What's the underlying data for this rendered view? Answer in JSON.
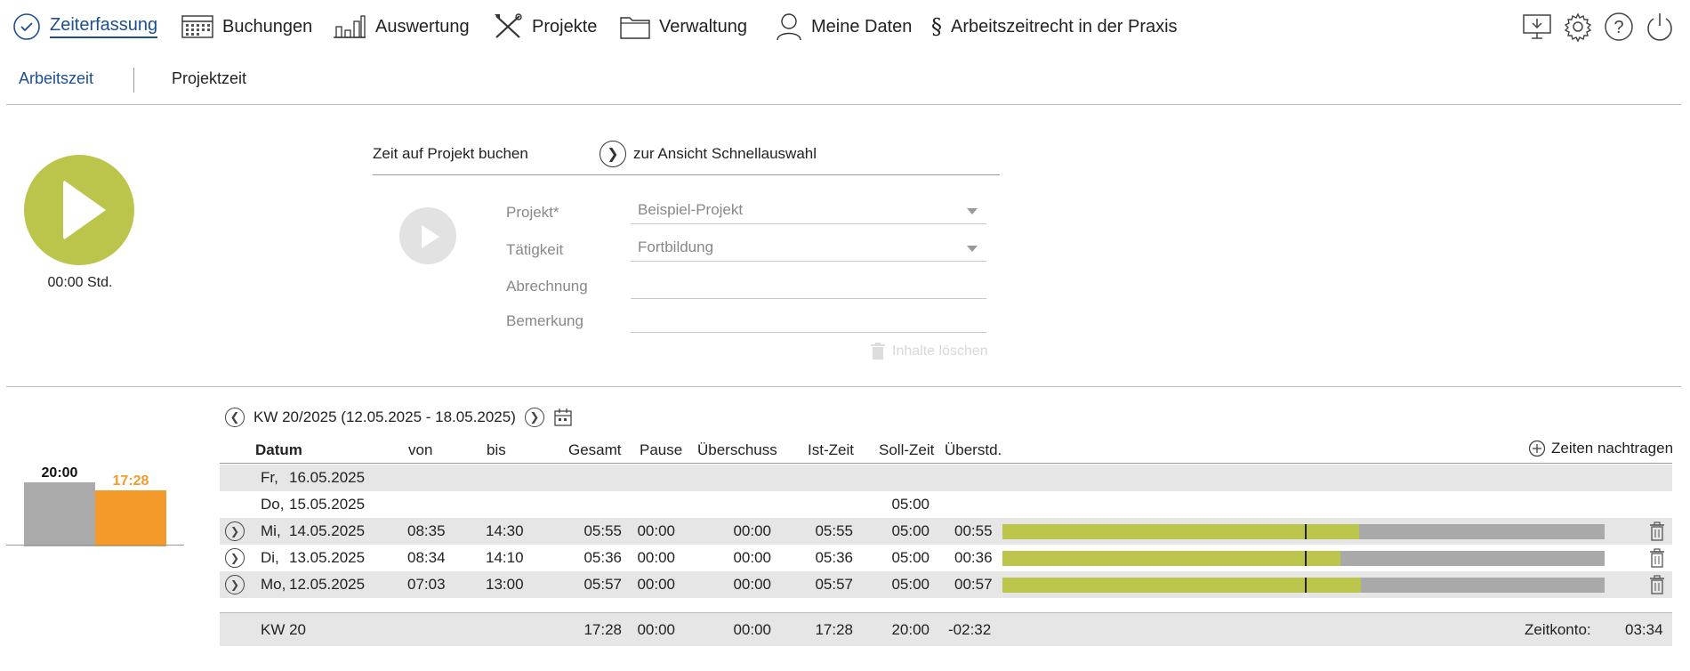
{
  "nav": {
    "items": [
      {
        "label": "Zeiterfassung",
        "icon": "clock-check-icon",
        "active": true
      },
      {
        "label": "Buchungen",
        "icon": "calendar-grid-icon"
      },
      {
        "label": "Auswertung",
        "icon": "bar-chart-icon"
      },
      {
        "label": "Projekte",
        "icon": "tools-icon"
      },
      {
        "label": "Verwaltung",
        "icon": "folder-icon"
      },
      {
        "label": "Meine Daten",
        "icon": "user-icon"
      },
      {
        "label": "Arbeitszeitrecht in der Praxis",
        "icon": "paragraph-icon",
        "glyph": "§"
      }
    ],
    "utilities": [
      "monitor-download-icon",
      "settings-gear-icon",
      "help-icon",
      "power-icon"
    ]
  },
  "subnav": {
    "tabs": [
      {
        "label": "Arbeitszeit",
        "active": true
      },
      {
        "label": "Projektzeit"
      }
    ]
  },
  "timer": {
    "label": "00:00 Std.",
    "color": "#bcc54b"
  },
  "booking": {
    "title": "Zeit auf Projekt buchen",
    "quick_link": "zur Ansicht Schnellauswahl",
    "fields": {
      "projekt": {
        "label": "Projekt*",
        "value": "Beispiel-Projekt"
      },
      "taetigkeit": {
        "label": "Tätigkeit",
        "value": "Fortbildung"
      },
      "abrechnung": {
        "label": "Abrechnung",
        "value": ""
      },
      "bemerkung": {
        "label": "Bemerkung",
        "value": ""
      }
    },
    "clear_label": "Inhalte löschen"
  },
  "chart": {
    "soll": {
      "label": "20:00",
      "value": 20.0,
      "color": "#aaaaaa"
    },
    "ist": {
      "label": "17:28",
      "value": 17.47,
      "color": "#f39a2b"
    }
  },
  "week": {
    "label": "KW 20/2025 (12.05.2025 - 18.05.2025)"
  },
  "table": {
    "headers": {
      "datum": "Datum",
      "von": "von",
      "bis": "bis",
      "gesamt": "Gesamt",
      "pause": "Pause",
      "ueberschuss": "Überschuss",
      "ist": "Ist-Zeit",
      "soll": "Soll-Zeit",
      "ueberstd": "Überstd."
    },
    "add_label": "Zeiten nachtragen",
    "rows": [
      {
        "day": "Fr,",
        "date": "16.05.2025",
        "von": "",
        "bis": "",
        "gesamt": "",
        "pause": "",
        "ueberschuss": "",
        "ist": "",
        "soll": "",
        "ueberstd": "",
        "progress": null
      },
      {
        "day": "Do,",
        "date": "15.05.2025",
        "von": "",
        "bis": "",
        "gesamt": "",
        "pause": "",
        "ueberschuss": "",
        "ist": "",
        "soll": "05:00",
        "ueberstd": "",
        "progress": null
      },
      {
        "day": "Mi,",
        "date": "14.05.2025",
        "von": "08:35",
        "bis": "14:30",
        "gesamt": "05:55",
        "pause": "00:00",
        "ueberschuss": "00:00",
        "ist": "05:55",
        "soll": "05:00",
        "ueberstd": "00:55",
        "progress": 0.593
      },
      {
        "day": "Di,",
        "date": "13.05.2025",
        "von": "08:34",
        "bis": "14:10",
        "gesamt": "05:36",
        "pause": "00:00",
        "ueberschuss": "00:00",
        "ist": "05:36",
        "soll": "05:00",
        "ueberstd": "00:36",
        "progress": 0.562
      },
      {
        "day": "Mo,",
        "date": "12.05.2025",
        "von": "07:03",
        "bis": "13:00",
        "gesamt": "05:57",
        "pause": "00:00",
        "ueberschuss": "00:00",
        "ist": "05:57",
        "soll": "05:00",
        "ueberstd": "00:57",
        "progress": 0.595
      }
    ],
    "soll_marker": 0.502,
    "summary": {
      "label": "KW 20",
      "gesamt": "17:28",
      "pause": "00:00",
      "ueberschuss": "00:00",
      "ist": "17:28",
      "soll": "20:00",
      "ueberstd": "-02:32",
      "konto_label": "Zeitkonto:",
      "konto_value": "03:34"
    }
  }
}
